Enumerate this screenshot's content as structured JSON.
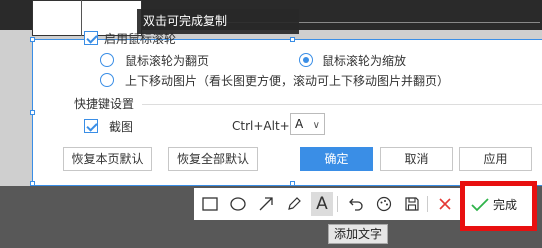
{
  "background": {
    "section_fragment": "置"
  },
  "tooltip_double_click": "双击可完成复制",
  "settings": {
    "enable_scroll_label": "启用鼠标滚轮",
    "scroll_options": [
      {
        "label": "鼠标滚轮为翻页",
        "selected": false
      },
      {
        "label": "鼠标滚轮为缩放",
        "selected": true
      },
      {
        "label": "上下移动图片（看长图更方便，滚动可上下移动图片并翻页）",
        "selected": false
      }
    ],
    "shortcut_heading": "快捷键设置",
    "screenshot_label": "截图",
    "screenshot_checked": true,
    "shortcut_modifier": "Ctrl+Alt+",
    "shortcut_key": "A"
  },
  "buttons": {
    "restore_page": "恢复本页默认",
    "restore_all": "恢复全部默认",
    "ok": "确定",
    "cancel": "取消",
    "apply": "应用"
  },
  "toolbar": {
    "tools": [
      "rectangle-icon",
      "ellipse-icon",
      "arrow-icon",
      "pen-icon",
      "text-icon",
      "undo-icon",
      "mosaic-icon",
      "save-icon",
      "close-icon"
    ],
    "text_tool_glyph": "A",
    "active_tool": "text"
  },
  "done_label": "完成",
  "tooltip_text_tool": "添加文字",
  "colors": {
    "accent": "#3a8ee6",
    "highlight_border": "#e81010",
    "done_check": "#2fb34a",
    "close_x": "#e53935"
  }
}
